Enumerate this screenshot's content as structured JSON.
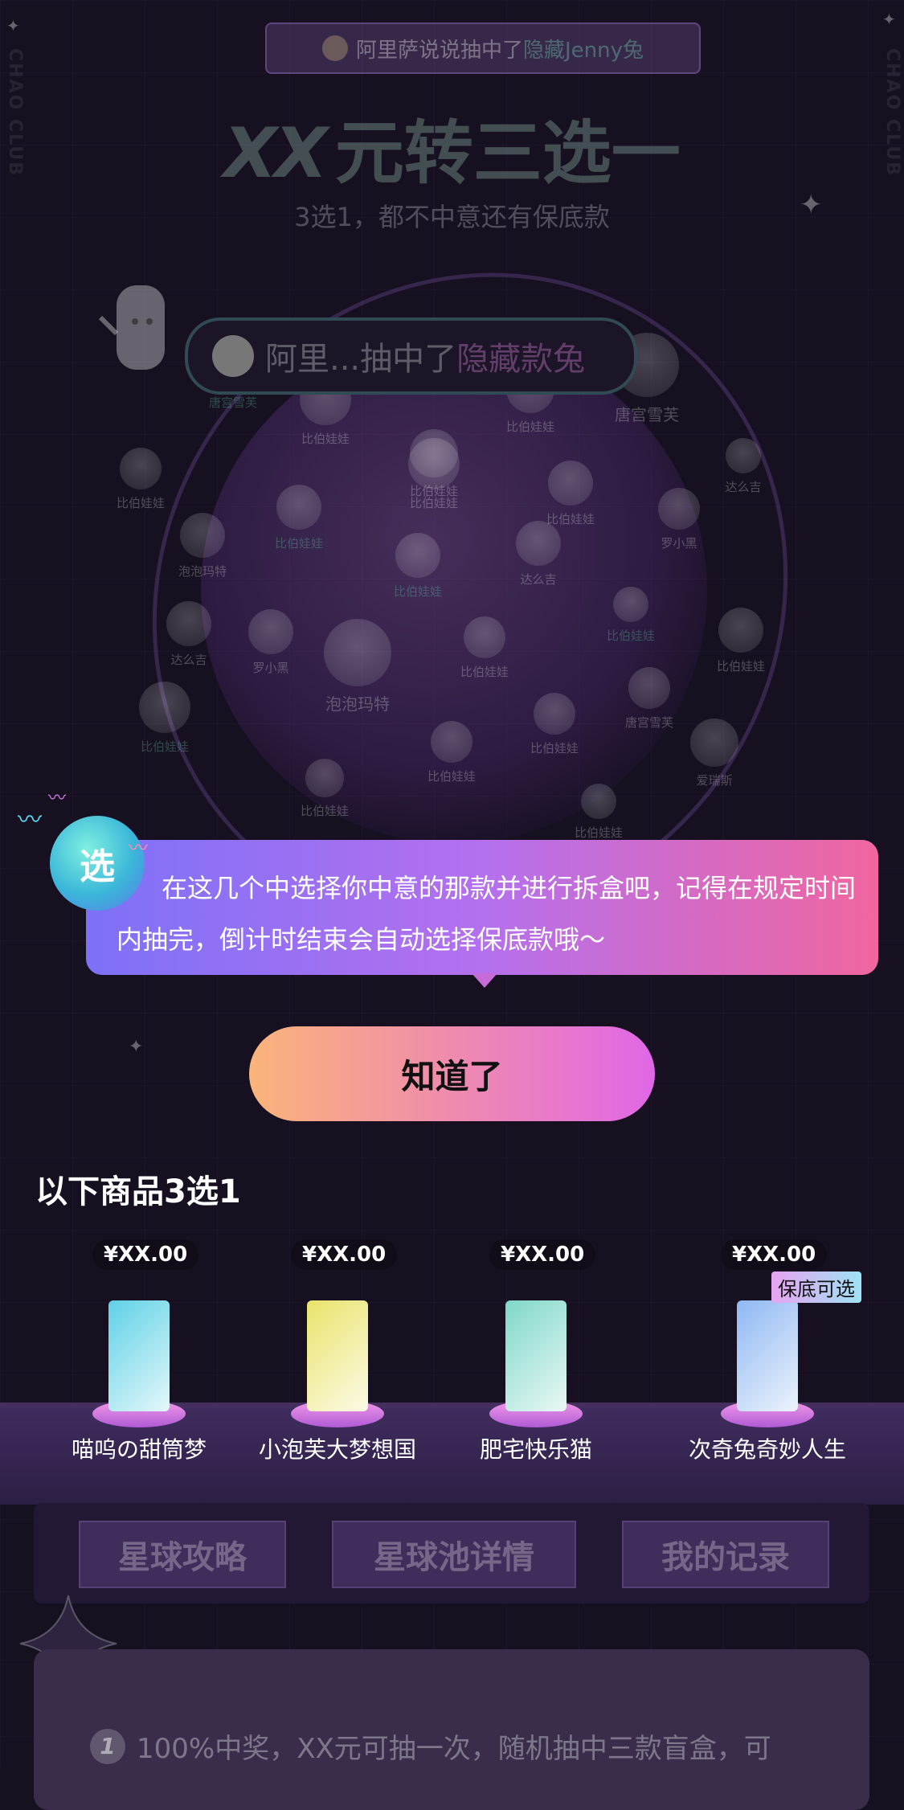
{
  "ticker": {
    "prefix": "阿里萨说说抽中了",
    "highlight": "隐藏Jenny兔"
  },
  "header": {
    "title_xx": "XX",
    "title_rest": "元转三选一",
    "subtitle": "3选1，都不中意还有保底款"
  },
  "winner_pill": {
    "prefix": "阿里...抽中了",
    "highlight": "隐藏款兔"
  },
  "watermark": "CHAO CLUB",
  "dolls": [
    {
      "label": "唐宫雪芙",
      "green": true
    },
    {
      "label": "比伯娃娃",
      "green": false
    },
    {
      "label": "比伯娃娃",
      "green": false
    },
    {
      "label": "比伯娃娃",
      "green": false
    },
    {
      "label": "唐宫雪芙",
      "green": false
    },
    {
      "label": "比伯娃娃",
      "green": false
    },
    {
      "label": "比伯娃娃",
      "green": false
    },
    {
      "label": "比伯娃娃",
      "green": false
    },
    {
      "label": "达么吉",
      "green": false
    },
    {
      "label": "泡泡玛特",
      "green": false
    },
    {
      "label": "比伯娃娃",
      "green": true
    },
    {
      "label": "罗小黑",
      "green": false
    },
    {
      "label": "比伯娃娃",
      "green": true
    },
    {
      "label": "达么吉",
      "green": false
    },
    {
      "label": "比伯娃娃",
      "green": true
    },
    {
      "label": "达么吉",
      "green": false
    },
    {
      "label": "罗小黑",
      "green": false
    },
    {
      "label": "泡泡玛特",
      "green": false
    },
    {
      "label": "比伯娃娃",
      "green": false
    },
    {
      "label": "比伯娃娃",
      "green": false
    },
    {
      "label": "比伯娃娃",
      "green": true
    },
    {
      "label": "唐宫雪芙",
      "green": false
    },
    {
      "label": "比伯娃娃",
      "green": false
    },
    {
      "label": "比伯娃娃",
      "green": false
    },
    {
      "label": "比伯娃娃",
      "green": false
    },
    {
      "label": "爱瑞斯",
      "green": false
    },
    {
      "label": "比伯娃娃",
      "green": false
    }
  ],
  "tip": {
    "badge": "选",
    "text": "在这几个中选择你中意的那款并进行拆盒吧，记得在规定时间内抽完，倒计时结束会自动选择保底款哦～"
  },
  "confirm_button": "知道了",
  "section_title": "以下商品3选1",
  "products": [
    {
      "price": "¥XX.00",
      "name": "喵呜の甜筒梦",
      "box_color": "#5fd1e6"
    },
    {
      "price": "¥XX.00",
      "name": "小泡芙大梦想国",
      "box_color": "#e9e36a"
    },
    {
      "price": "¥XX.00",
      "name": "肥宅快乐猫",
      "box_color": "#7fd7c8"
    },
    {
      "price": "¥XX.00",
      "name": "次奇兔奇妙人生",
      "box_color": "#8fb8f2"
    }
  ],
  "guarantee_tag": "保底可选",
  "tabs": [
    "星球攻略",
    "星球池详情",
    "我的记录"
  ],
  "rule": {
    "num": "1",
    "text": "100%中奖，XX元可抽一次，随机抽中三款盲盒，可"
  }
}
